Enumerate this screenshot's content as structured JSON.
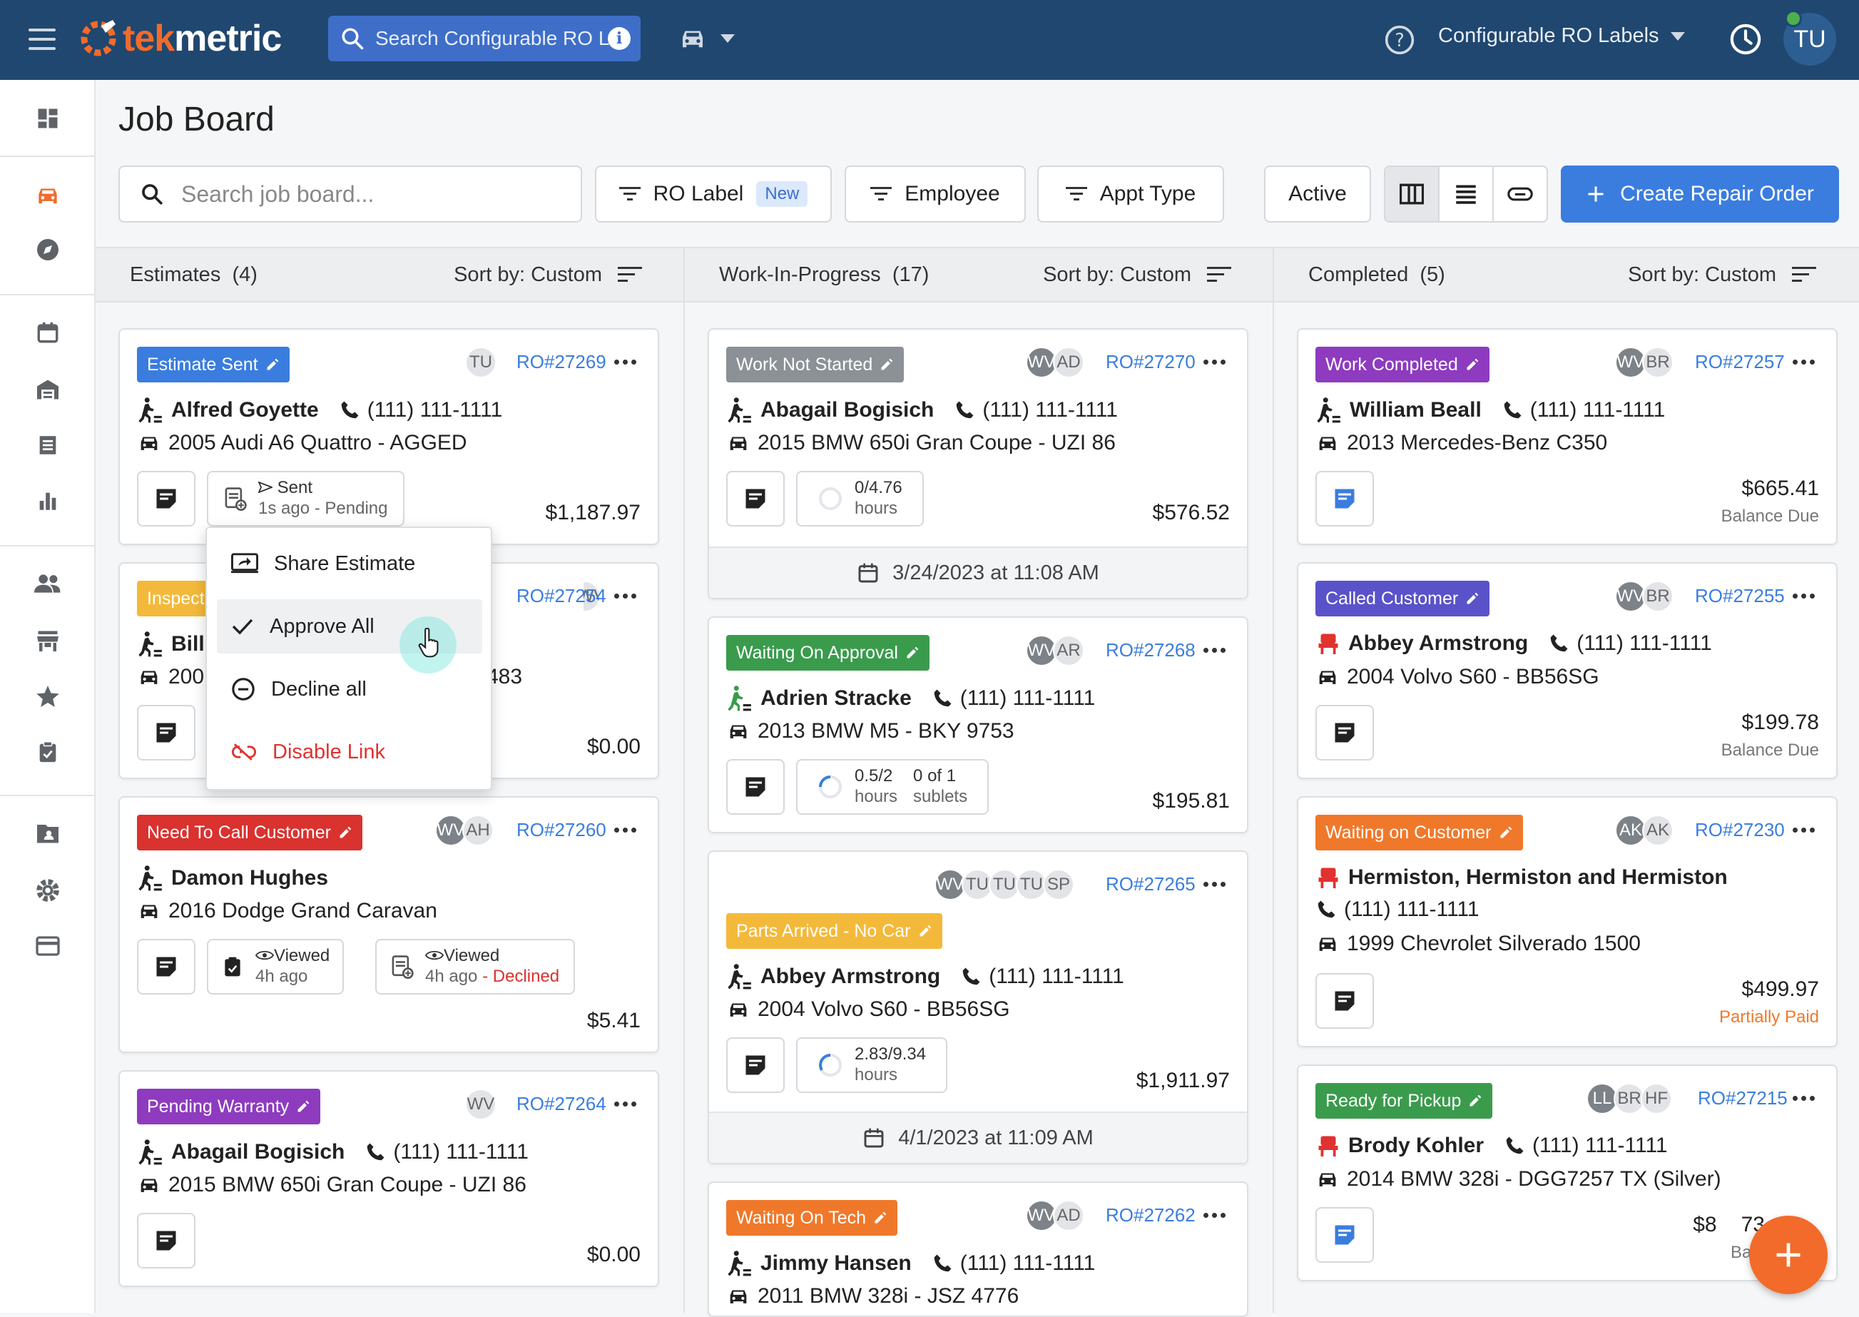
{
  "topbar": {
    "logo_prefix": "tek",
    "logo_suffix": "metric",
    "search_placeholder": "Search Configurable RO L",
    "ro_labels_menu": "Configurable RO Labels",
    "user_initials": "TU"
  },
  "page": {
    "title": "Job Board",
    "search_placeholder": "Search job board...",
    "filters": {
      "ro_label": "RO Label",
      "new_badge": "New",
      "employee": "Employee",
      "appt_type": "Appt Type",
      "active": "Active"
    },
    "create_label": "Create Repair Order"
  },
  "columns": [
    {
      "title": "Estimates",
      "count": "(4)",
      "sort": "Sort by: Custom"
    },
    {
      "title": "Work-In-Progress",
      "count": "(17)",
      "sort": "Sort by: Custom"
    },
    {
      "title": "Completed",
      "count": "(5)",
      "sort": "Sort by: Custom"
    }
  ],
  "colors": {
    "blue": "#3a7ddf",
    "gray": "#8b9196",
    "green": "#3a9b4c",
    "purple": "#8e3bbf",
    "red": "#d9322f",
    "yellow": "#f3b93a",
    "orange": "#f0782a",
    "indigo": "#5a52c9",
    "topbar": "#20476f"
  },
  "estimates": [
    {
      "status": "Estimate Sent",
      "avatars": [
        "TU"
      ],
      "ro": "RO#27269",
      "customer": "Alfred Goyette",
      "phone": "(111) 111-1111",
      "vehicle": "2005 Audi A6 Quattro - AGGED",
      "chip_title": "Sent",
      "chip_sub": "1s ago - Pending",
      "price": "$1,187.97"
    },
    {
      "status": "Inspect",
      "avatars": [
        "WV"
      ],
      "ro": "RO#27254",
      "customer": "Bill",
      "vehicle_prefix": "200",
      "vehicle_suffix": "483",
      "price": "$0.00"
    },
    {
      "status": "Need To Call Customer",
      "avatars": [
        "WV",
        "AH"
      ],
      "ro": "RO#27260",
      "customer": "Damon Hughes",
      "vehicle": "2016 Dodge Grand Caravan",
      "chip1_title": "Viewed",
      "chip1_sub": "4h ago",
      "chip2_title": "Viewed",
      "chip2_sub": "4h ago",
      "chip2_state": "- Declined",
      "price": "$5.41"
    },
    {
      "status": "Pending Warranty",
      "avatars": [
        "WV"
      ],
      "ro": "RO#27264",
      "customer": "Abagail Bogisich",
      "phone": "(111) 111-1111",
      "vehicle": "2015 BMW 650i Gran Coupe - UZI 86",
      "price": "$0.00"
    }
  ],
  "wip": [
    {
      "status": "Work Not Started",
      "avatars": [
        "WV",
        "AD"
      ],
      "ro": "RO#27270",
      "customer": "Abagail Bogisich",
      "phone": "(111) 111-1111",
      "vehicle": "2015 BMW 650i Gran Coupe - UZI 86",
      "hours": "0/4.76",
      "hours_label": "hours",
      "price": "$576.52",
      "date": "3/24/2023 at 11:08 AM"
    },
    {
      "status": "Waiting On Approval",
      "avatars": [
        "WV",
        "AR"
      ],
      "ro": "RO#27268",
      "customer": "Adrien Stracke",
      "phone": "(111) 111-1111",
      "vehicle": "2013 BMW M5 - BKY 9753",
      "hours": "0.5/2",
      "hours_label": "hours",
      "sublets": "0 of 1",
      "sublets_label": "sublets",
      "price": "$195.81"
    },
    {
      "status": "Parts Arrived - No Car",
      "avatars": [
        "WV",
        "TU",
        "TU",
        "TU",
        "SP"
      ],
      "ro": "RO#27265",
      "customer": "Abbey Armstrong",
      "phone": "(111) 111-1111",
      "vehicle": "2004 Volvo S60 - BB56SG",
      "hours": "2.83/9.34",
      "hours_label": "hours",
      "price": "$1,911.97",
      "date": "4/1/2023 at 11:09 AM"
    },
    {
      "status": "Waiting On Tech",
      "avatars": [
        "WV",
        "AD"
      ],
      "ro": "RO#27262",
      "customer": "Jimmy Hansen",
      "phone": "(111) 111-1111",
      "vehicle": "2011 BMW 328i - JSZ 4776"
    }
  ],
  "completed": [
    {
      "status": "Work Completed",
      "avatars": [
        "WV",
        "BR"
      ],
      "ro": "RO#27257",
      "customer": "William Beall",
      "phone": "(111) 111-1111",
      "vehicle": "2013 Mercedes-Benz C350",
      "price": "$665.41",
      "price_note": "Balance Due"
    },
    {
      "status": "Called Customer",
      "avatars": [
        "WV",
        "BR"
      ],
      "ro": "RO#27255",
      "customer": "Abbey Armstrong",
      "phone": "(111) 111-1111",
      "vehicle": "2004 Volvo S60 - BB56SG",
      "price": "$199.78",
      "price_note": "Balance Due"
    },
    {
      "status": "Waiting on Customer",
      "avatars": [
        "AK",
        "AK"
      ],
      "ro": "RO#27230",
      "customer": "Hermiston, Hermiston and Hermiston",
      "phone": "(111) 111-1111",
      "vehicle": "1999 Chevrolet Silverado 1500",
      "price": "$499.97",
      "price_note": "Partially Paid"
    },
    {
      "status": "Ready for Pickup",
      "avatars": [
        "LL",
        "BR",
        "HF"
      ],
      "ro": "RO#27215",
      "customer": "Brody Kohler",
      "phone": "(111) 111-1111",
      "vehicle": "2014 BMW 328i - DGG7257 TX (Silver)",
      "price": "$8",
      "price_suffix": "73",
      "price_note": "Bala"
    }
  ],
  "menu": {
    "share": "Share Estimate",
    "approve": "Approve All",
    "decline": "Decline all",
    "disable": "Disable Link"
  }
}
